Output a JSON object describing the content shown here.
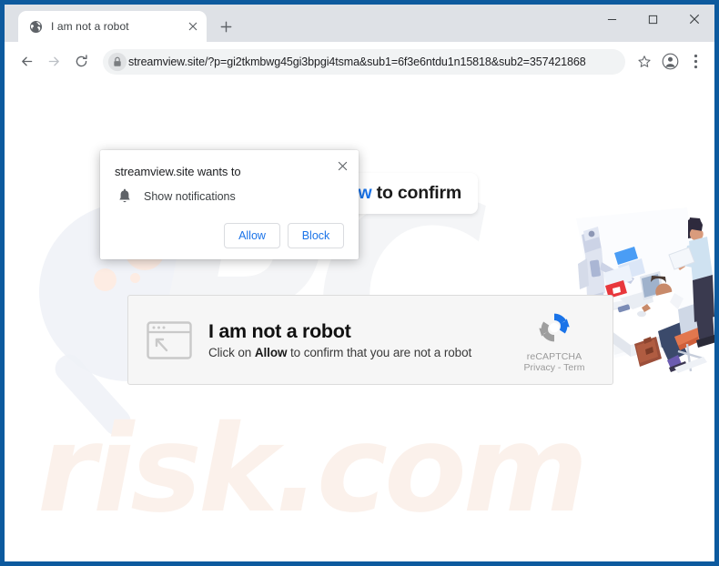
{
  "window": {
    "controls": [
      {
        "name": "minimize",
        "glyph": "–"
      },
      {
        "name": "maximize",
        "glyph": "□"
      },
      {
        "name": "close",
        "glyph": "✕"
      }
    ]
  },
  "tabstrip": {
    "tab": {
      "title": "I am not a robot",
      "favicon": "globe-icon",
      "close_glyph": "✕"
    },
    "new_tab_glyph": "+",
    "new_tab_label": "New Tab"
  },
  "toolbar": {
    "back_label": "Back",
    "forward_label": "Forward",
    "reload_label": "Reload",
    "lock_icon": "lock-icon",
    "url": "streamview.site/?p=gi2tkmbwg45gi3bpgi4tsma&sub1=6f3e6ntdu1n15818&sub2=357421868",
    "bookmark_icon": "star-icon",
    "profile_icon": "avatar-icon",
    "menu_icon": "three-dot-menu-icon"
  },
  "permission_popup": {
    "title": "streamview.site wants to",
    "permission_icon": "bell-icon",
    "permission_label": "Show notifications",
    "allow_label": "Allow",
    "block_label": "Block",
    "close_glyph": "✕",
    "accent_color": "#1a73e8"
  },
  "page": {
    "hero_banner": {
      "blue_fragment": "ow",
      "rest_fragment": " to confirm",
      "accent_color": "#1a73e8"
    },
    "captcha": {
      "window_icon": "browser-window-cursor-icon",
      "title": "I am not a robot",
      "subtitle_before": "Click on ",
      "subtitle_bold": "Allow",
      "subtitle_after": " to confirm that you are not a robot",
      "badge": {
        "logo_icon": "recaptcha-logo-icon",
        "name": "reCAPTCHA",
        "links": "Privacy - Term"
      }
    },
    "watermark": {
      "top_text": "PC",
      "bottom_text": "risk.com",
      "top_color": "#f4f5f7",
      "bottom_color": "#fbf1eb"
    },
    "illustration": {
      "name": "office-robot-illustration",
      "alt": "Isometric illustration of a robot and office workers at a desk"
    }
  },
  "colors": {
    "frame_border": "#0d5a9e",
    "tabstrip_bg": "#dee1e6",
    "omnibox_bg": "#f1f3f4",
    "captcha_bg": "#f6f6f6",
    "link_blue": "#1a73e8"
  }
}
